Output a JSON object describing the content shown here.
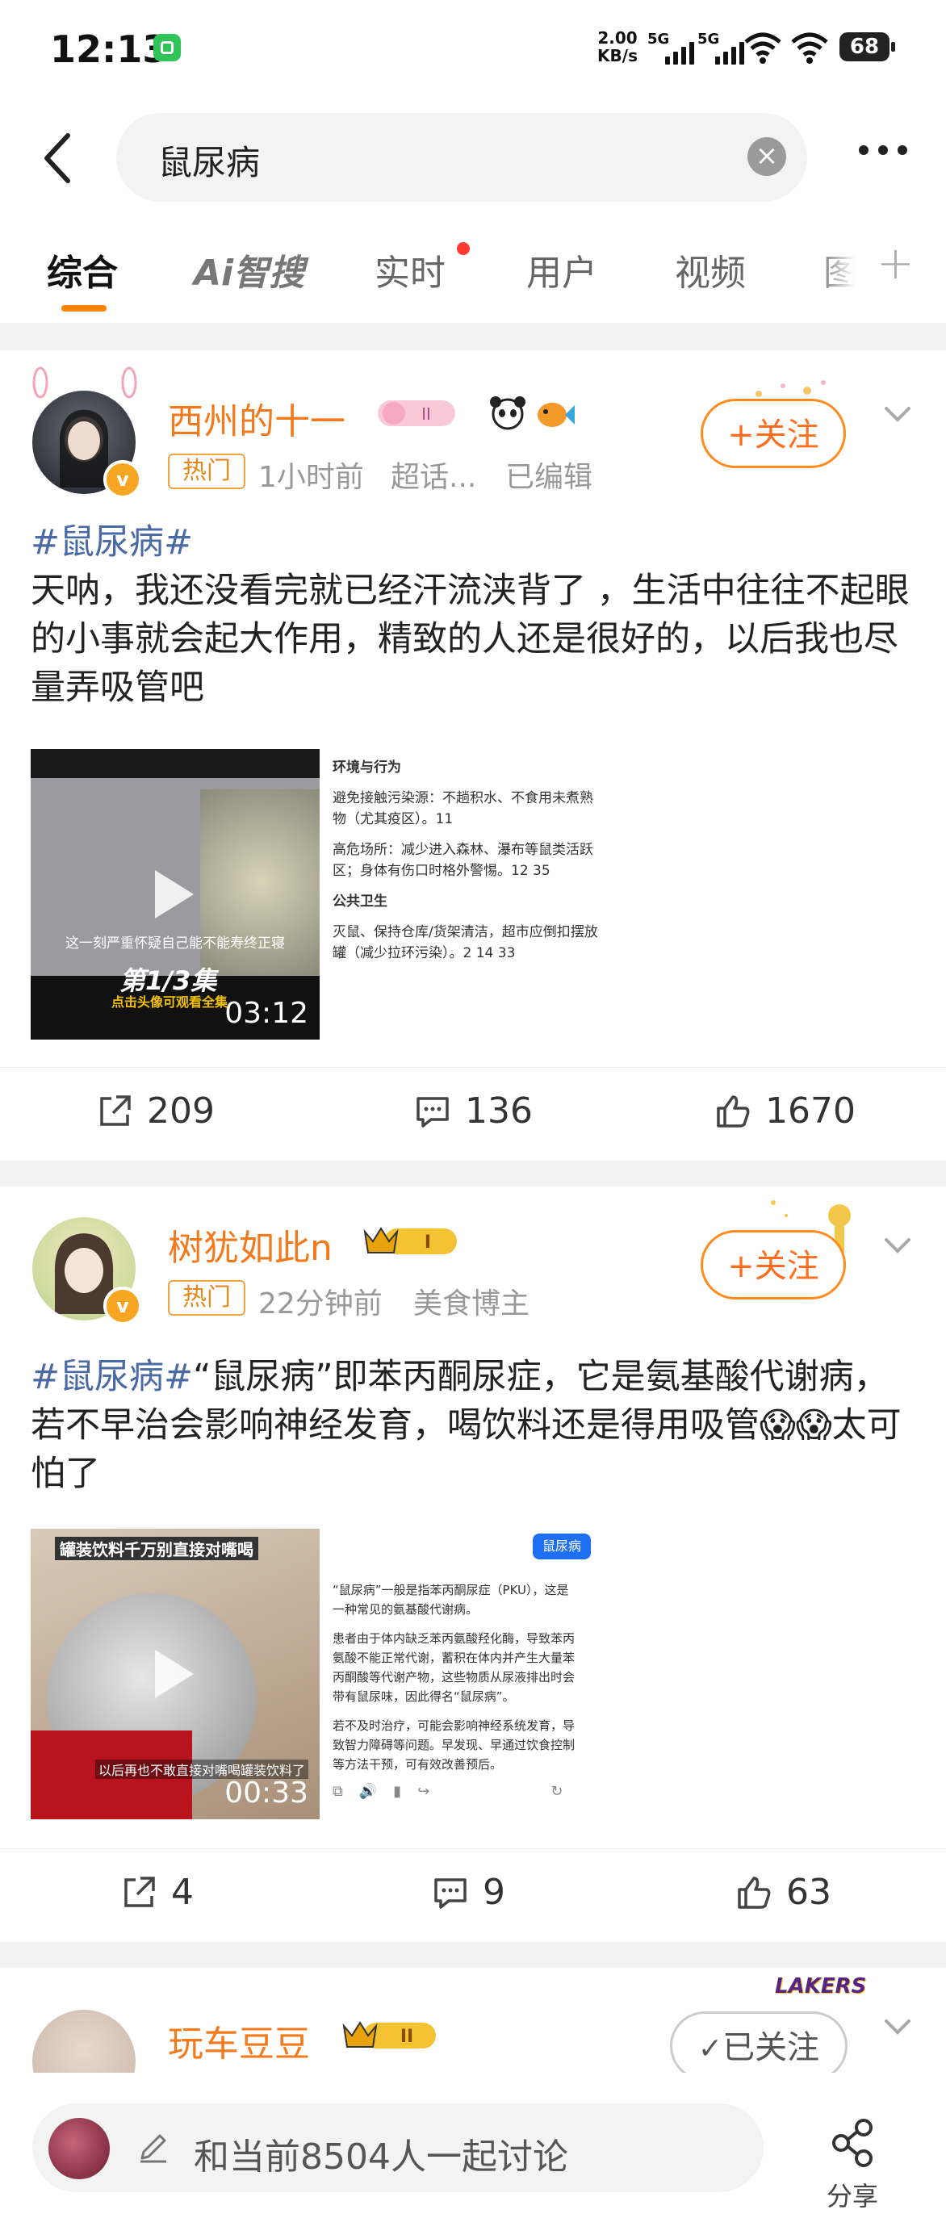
{
  "status_bar": {
    "time": "12:13",
    "net_speed_value": "2.00",
    "net_speed_unit": "KB/s",
    "signal1_label": "5G",
    "signal2_label": "5G",
    "battery": "68"
  },
  "search": {
    "query": "鼠尿病"
  },
  "tabs": [
    {
      "label": "综合"
    },
    {
      "label": "Ai智搜"
    },
    {
      "label": "实时"
    },
    {
      "label": "用户"
    },
    {
      "label": "视频"
    },
    {
      "label": "图"
    }
  ],
  "posts": [
    {
      "username": "西州的十一",
      "hot_label": "热门",
      "time": "1小时前",
      "source": "超话...",
      "edited": "已编辑",
      "follow_label": "+关注",
      "hashtag": "#鼠尿病#",
      "text": "天呐，我还没看完就已经汗流浃背了 ，生活中往往不起眼的小事就会起大作用，精致的人还是很好的，以后我也尽量弄吸管吧",
      "video_duration": "03:12",
      "video_caption": "第1/3集",
      "video_subcaption": "点击头像可观看全集",
      "video_text": "这一刻严重怀疑自己能不能寿终正寝",
      "side_lines": [
        "环境与行为",
        "避免接触污染源：不趟积水、不食用未煮熟",
        "物（尤其疫区）。11",
        "高危场所：减少进入森林、瀑布等鼠类活跃",
        "区；身体有伤口时格外警惕。12 35",
        "公共卫生",
        "灭鼠、保持仓库/货架清洁，超市应倒扣摆放",
        "罐（减少拉环污染）。2 14 33"
      ],
      "reposts": "209",
      "comments": "136",
      "likes": "1670"
    },
    {
      "username": "树犹如此n",
      "hot_label": "热门",
      "time": "22分钟前",
      "source": "美食博主",
      "edited": "",
      "follow_label": "+关注",
      "hashtag": "#鼠尿病#",
      "text": "“鼠尿病”即苯丙酮尿症，它是氨基酸代谢病，若不早治会影响神经发育，喝饮料还是得用吸管😱😱太可怕了",
      "video_duration": "00:33",
      "video_caption": "罐装饮料千万别直接对嘴喝",
      "video_subcaption": "以后再也不敢直接对嘴喝罐装饮料了",
      "side_tag": "鼠尿病",
      "side_lines": [
        "“鼠尿病”一般是指苯丙酮尿症（PKU），这是一种常见的氨基酸代谢病。",
        "患者由于体内缺乏苯丙氨酸羟化酶，导致苯丙氨酸不能正常代谢，蓄积在体内并产生大量苯丙酮酸等代谢产物，这些物质从尿液排出时会带有鼠尿味，因此得名“鼠尿病”。",
        "若不及时治疗，可能会影响神经系统发育，导致智力障碍等问题。早发现、早通过饮食控制等方法干预，可有效改善预后。"
      ],
      "reposts": "4",
      "comments": "9",
      "likes": "63"
    },
    {
      "username": "玩车豆豆",
      "follow_label": "已关注",
      "team_logo_text": "LAKERS"
    }
  ],
  "bottom": {
    "discuss_placeholder": "和当前8504人一起讨论",
    "share_label": "分享"
  },
  "colors": {
    "accent": "#ff8200",
    "username": "#f27a1c",
    "hashtag": "#4a6aa5",
    "hot_badge": "#e6881c"
  }
}
